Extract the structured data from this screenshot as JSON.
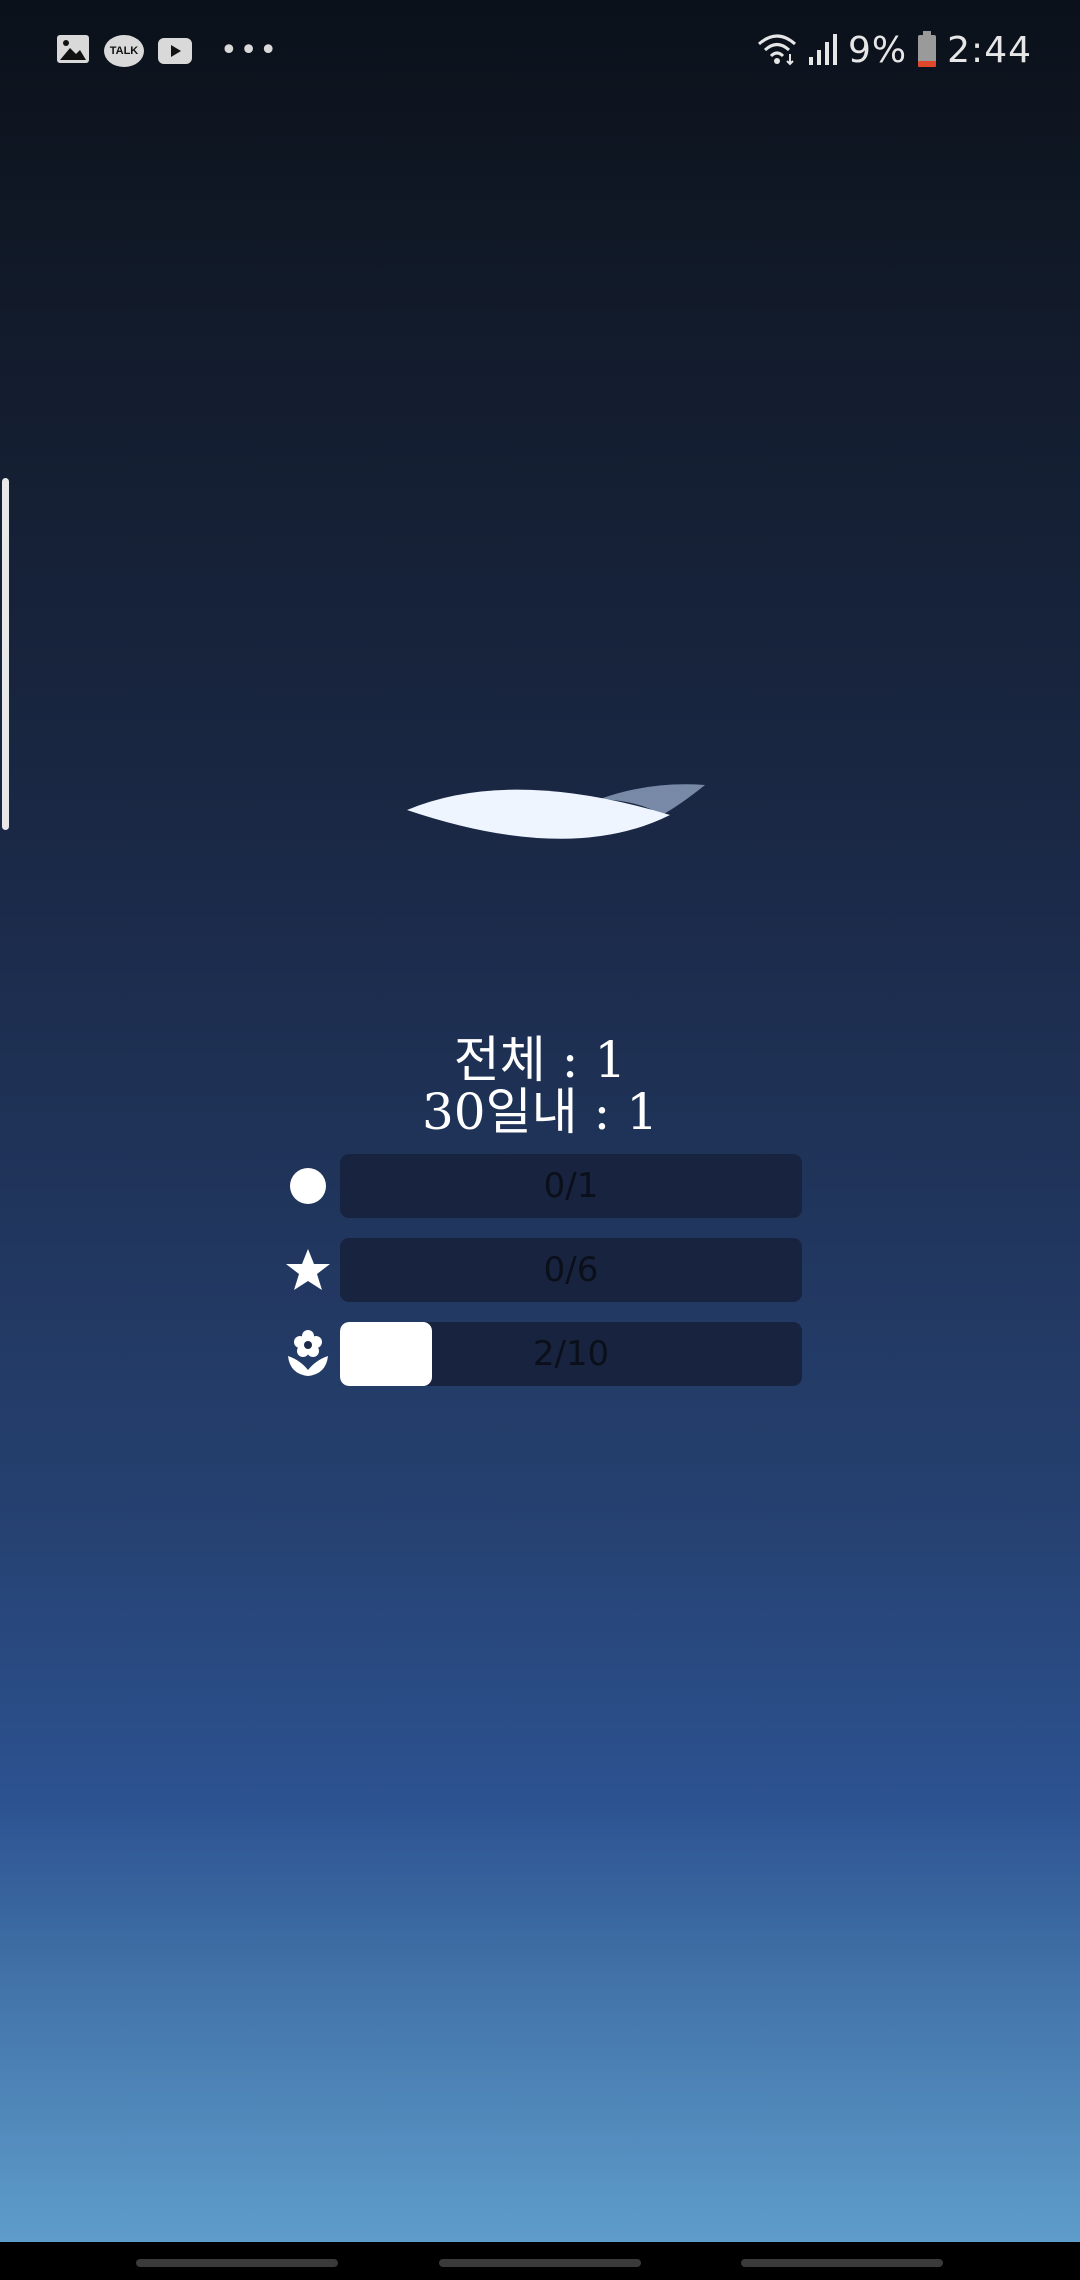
{
  "status_bar": {
    "left_icons": [
      "gallery-icon",
      "kakaotalk-icon",
      "youtube-icon",
      "more-dots-icon"
    ],
    "talk_label": "TALK",
    "more_label": "•••",
    "battery_percent": "9%",
    "time": "2:44"
  },
  "summary": {
    "total_line": "전체 : 1",
    "recent_line": "30일내 : 1"
  },
  "progress": [
    {
      "icon": "circle-icon",
      "label": "0/1",
      "fill": 0.0
    },
    {
      "icon": "star-icon",
      "label": "0/6",
      "fill": 0.0
    },
    {
      "icon": "flower-icon",
      "label": "2/10",
      "fill": 0.2
    },
    {
      "_": null
    }
  ],
  "colors": {
    "track": "#17233f",
    "fill": "#ffffff",
    "label": "#0a0f1a"
  }
}
